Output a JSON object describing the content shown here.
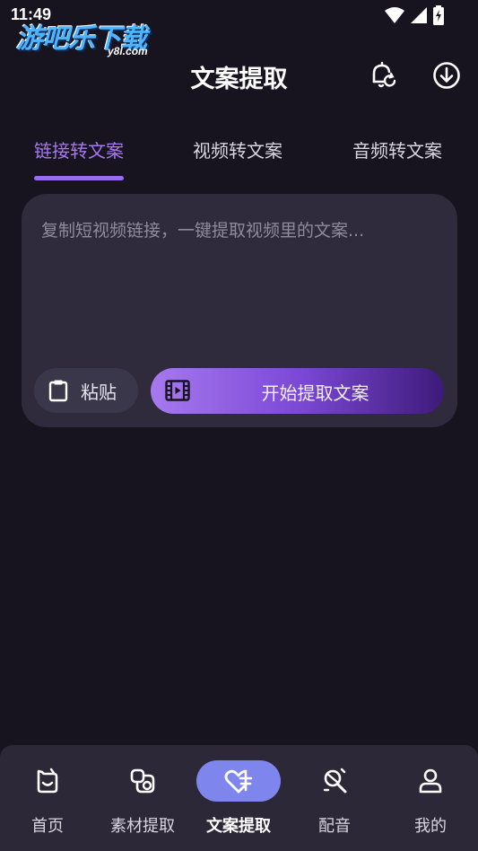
{
  "status_bar": {
    "time": "11:49",
    "icons": [
      "wifi-icon",
      "signal-icon",
      "battery-icon"
    ]
  },
  "watermark": {
    "main_text": "游吧乐下载",
    "sub_text": "y8l.com"
  },
  "header": {
    "title": "文案提取",
    "icons": [
      "bell-refresh-icon",
      "download-icon"
    ]
  },
  "tabs": [
    {
      "label": "链接转文案",
      "active": true
    },
    {
      "label": "视频转文案",
      "active": false
    },
    {
      "label": "音频转文案",
      "active": false
    }
  ],
  "input_card": {
    "placeholder": "复制短视频链接，一键提取视频里的文案...",
    "paste_label": "粘贴",
    "extract_label": "开始提取文案"
  },
  "bottom_nav": [
    {
      "label": "首页",
      "icon": "home-icon",
      "active": false
    },
    {
      "label": "素材提取",
      "icon": "material-icon",
      "active": false
    },
    {
      "label": "文案提取",
      "icon": "text-extract-icon",
      "active": true
    },
    {
      "label": "配音",
      "icon": "microphone-icon",
      "active": false
    },
    {
      "label": "我的",
      "icon": "user-icon",
      "active": false
    }
  ],
  "colors": {
    "background": "#17141f",
    "accent": "#a678f2",
    "card": "#2f2b3d",
    "nav_active": "#7e86ee"
  }
}
